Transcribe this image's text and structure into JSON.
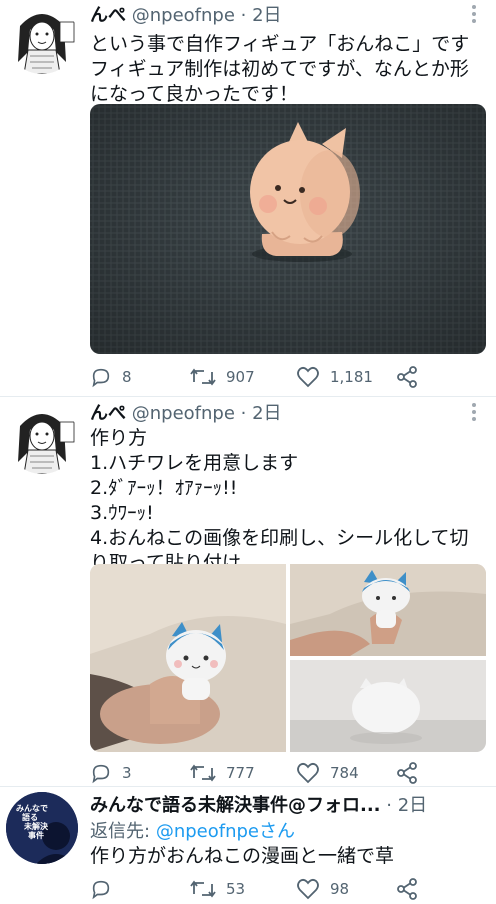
{
  "tweets": [
    {
      "name": "んぺ",
      "handle": "@npeofnpe",
      "time": "2日",
      "lines": [
        "という事で自作フィギュア「おんねこ」です",
        "フィギュア制作は初めてですが、なんとか形",
        "になって良かったです！"
      ],
      "reply_count": "8",
      "retweet_count": "907",
      "like_count": "1,181"
    },
    {
      "name": "んぺ",
      "handle": "@npeofnpe",
      "time": "2日",
      "lines": [
        "作り方",
        "1.ハチワレを用意します",
        "2.ﾀﾞｱｰｯ！ｵｱｧｰｯ!!",
        "3.ｳﾜｰｯ!",
        "4.おんねこの画像を印刷し、シール化して切",
        "り取って貼り付け"
      ],
      "reply_count": "3",
      "retweet_count": "777",
      "like_count": "784"
    },
    {
      "name": "みんなで語る未解決事件@フォロ...",
      "time": "2日",
      "reply_prefix": "返信先:",
      "reply_to": "@npeofnpeさん",
      "lines": [
        "作り方がおんねこの漫画と一緒で草"
      ],
      "avatar_text": [
        "みんなで",
        "語る",
        "未解決",
        "事件"
      ],
      "reply_count": "",
      "retweet_count": "53",
      "like_count": "98"
    }
  ],
  "icons": {
    "reply": "reply-bubble-icon",
    "retweet": "retweet-icon",
    "like": "heart-icon",
    "share": "share-icon",
    "more": "more-dots-icon"
  },
  "colors": {
    "text": "#0f1419",
    "secondary": "#536471",
    "link": "#1d9bf0"
  }
}
